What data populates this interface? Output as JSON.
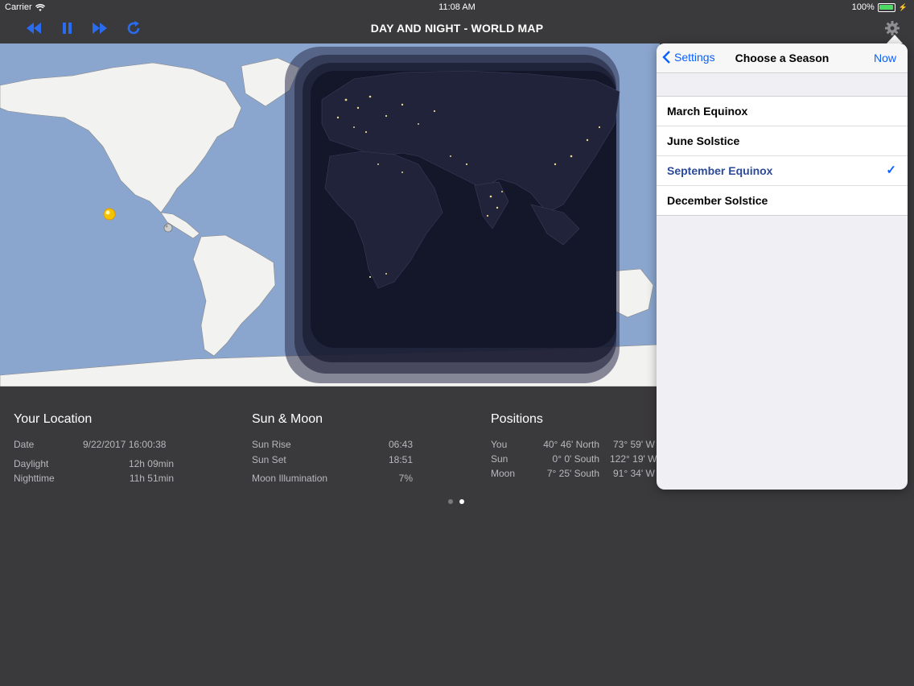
{
  "status": {
    "carrier": "Carrier",
    "time": "11:08 AM",
    "battery": "100%"
  },
  "nav": {
    "title": "DAY AND NIGHT - WORLD MAP"
  },
  "info": {
    "location": {
      "title": "Your Location",
      "date_label": "Date",
      "date_value": "9/22/2017 16:00:38",
      "daylight_label": "Daylight",
      "daylight_value": "12h 09min",
      "nighttime_label": "Nighttime",
      "nighttime_value": "11h 51min"
    },
    "sunmoon": {
      "title": "Sun & Moon",
      "sunrise_label": "Sun Rise",
      "sunrise_value": "06:43",
      "sunset_label": "Sun Set",
      "sunset_value": "18:51",
      "moon_label": "Moon Illumination",
      "moon_value": "7%"
    },
    "positions": {
      "title": "Positions",
      "you_label": "You",
      "you_lat": "40° 46' North",
      "you_lon": "73° 59' W",
      "sun_label": "Sun",
      "sun_lat": "0° 0' South",
      "sun_lon": "122° 19' W",
      "moon_label": "Moon",
      "moon_lat": "7° 25' South",
      "moon_lon": "91° 34' W"
    }
  },
  "popover": {
    "back": "Settings",
    "title": "Choose a Season",
    "now": "Now",
    "items": [
      "March Equinox",
      "June Solstice",
      "September Equinox",
      "December Solstice"
    ],
    "selected_index": 2
  },
  "colors": {
    "accent": "#0a60ff",
    "ocean": "#8aa6cf",
    "land": "#f2f2f0",
    "night": "#14162a"
  }
}
